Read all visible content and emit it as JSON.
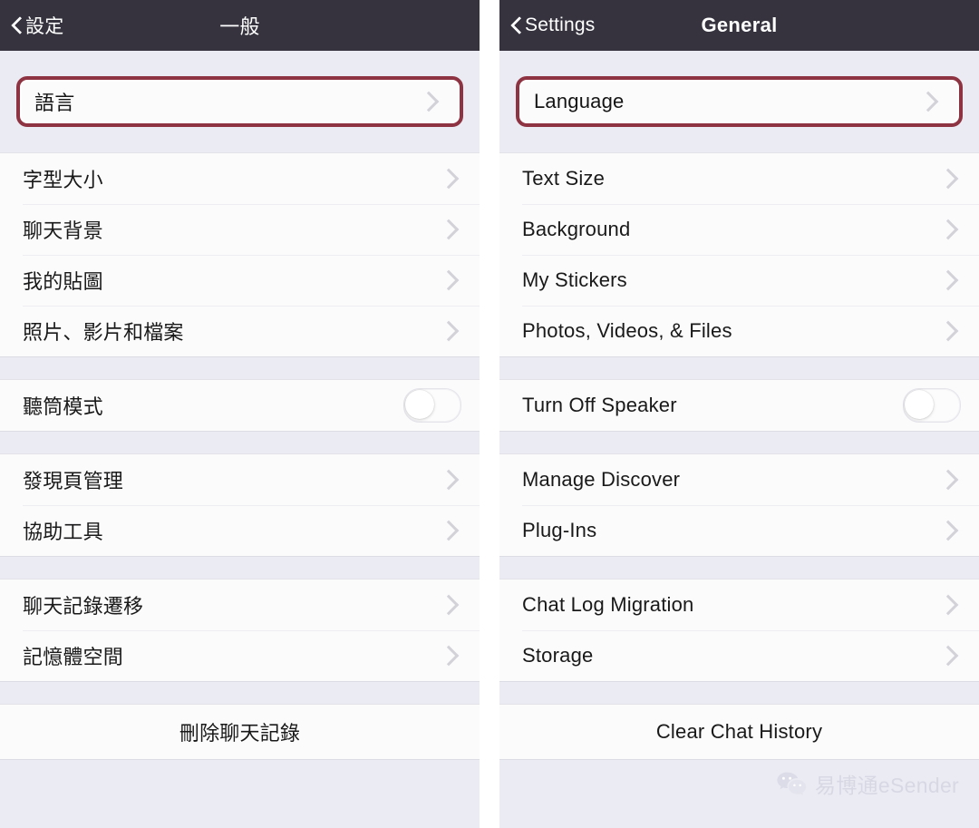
{
  "panels": {
    "left": {
      "lang": "zh-Hant",
      "nav": {
        "back_label": "設定",
        "back_icon": "chevron-left-icon",
        "title": "一般"
      },
      "highlight": {
        "label": "語言",
        "chevron_icon": "chevron-right-icon",
        "outline_color": "#8d3341"
      },
      "groups": [
        {
          "rows": [
            {
              "label": "字型大小",
              "type": "link"
            },
            {
              "label": "聊天背景",
              "type": "link"
            },
            {
              "label": "我的貼圖",
              "type": "link"
            },
            {
              "label": "照片、影片和檔案",
              "type": "link"
            }
          ]
        },
        {
          "rows": [
            {
              "label": "聽筒模式",
              "type": "toggle",
              "value": "off"
            }
          ]
        },
        {
          "rows": [
            {
              "label": "發現頁管理",
              "type": "link"
            },
            {
              "label": "協助工具",
              "type": "link"
            }
          ]
        },
        {
          "rows": [
            {
              "label": "聊天記錄遷移",
              "type": "link"
            },
            {
              "label": "記憶體空間",
              "type": "link"
            }
          ]
        }
      ],
      "action": {
        "label": "刪除聊天記錄"
      }
    },
    "right": {
      "lang": "en",
      "nav": {
        "back_label": "Settings",
        "back_icon": "chevron-left-icon",
        "title": "General"
      },
      "highlight": {
        "label": "Language",
        "chevron_icon": "chevron-right-icon",
        "outline_color": "#8d3341"
      },
      "groups": [
        {
          "rows": [
            {
              "label": "Text Size",
              "type": "link"
            },
            {
              "label": "Background",
              "type": "link"
            },
            {
              "label": "My Stickers",
              "type": "link"
            },
            {
              "label": "Photos, Videos, & Files",
              "type": "link"
            }
          ]
        },
        {
          "rows": [
            {
              "label": "Turn Off Speaker",
              "type": "toggle",
              "value": "off"
            }
          ]
        },
        {
          "rows": [
            {
              "label": "Manage Discover",
              "type": "link"
            },
            {
              "label": "Plug-Ins",
              "type": "link"
            }
          ]
        },
        {
          "rows": [
            {
              "label": "Chat Log Migration",
              "type": "link"
            },
            {
              "label": "Storage",
              "type": "link"
            }
          ]
        }
      ],
      "action": {
        "label": "Clear Chat History"
      },
      "watermark": {
        "icon": "wechat-bubbles-icon",
        "text": "易博通eSender"
      }
    }
  },
  "theme": {
    "navbar_bg": "#36333f",
    "page_bg": "#ebebf3",
    "row_bg": "#fbfbfc",
    "text": "#191919",
    "chevron": "#d2d2d8",
    "watermark": "#d8d8e4"
  }
}
